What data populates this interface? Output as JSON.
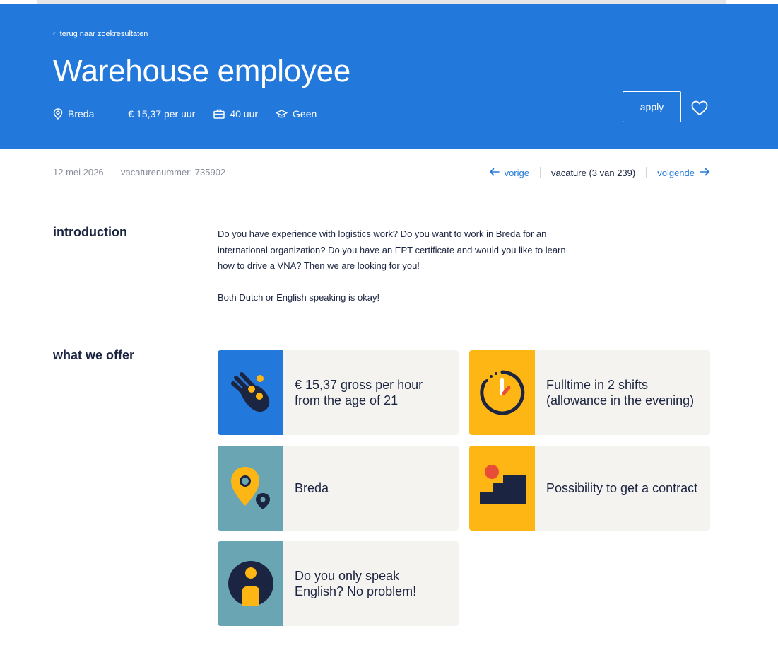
{
  "header": {
    "back_link": "terug naar zoekresultaten",
    "title": "Warehouse employee",
    "meta": {
      "location": "Breda",
      "salary": "€ 15,37 per uur",
      "hours": "40 uur",
      "education": "Geen"
    },
    "apply_label": "apply"
  },
  "info": {
    "date": "12 mei 2026",
    "vacancy_number": "vacaturenummer: 735902",
    "prev_label": "vorige",
    "count_label": "vacature (3 van 239)",
    "next_label": "volgende"
  },
  "introduction": {
    "heading": "introduction",
    "paragraphs": [
      "Do you have experience with logistics work? Do you want to work in Breda for an international organization? Do you have an EPT certificate and would you like to learn how to drive a VNA? Then we are looking for you!",
      "Both Dutch or English speaking is okay!"
    ]
  },
  "offer": {
    "heading": "what we offer",
    "cards": [
      {
        "text": "€ 15,37 gross per hour from the age of 21",
        "icon": "hand-coins-icon",
        "bg": "#2378db"
      },
      {
        "text": "Fulltime in 2 shifts (allowance in the evening)",
        "icon": "stopwatch-icon",
        "bg": "#fdb614"
      },
      {
        "text": "Breda",
        "icon": "location-pins-icon",
        "bg": "#6aa5b3"
      },
      {
        "text": "Possibility to get a contract",
        "icon": "stairs-icon",
        "bg": "#fdb614"
      },
      {
        "text": "Do you only speak English? No problem!",
        "icon": "person-icon",
        "bg": "#6aa5b3"
      }
    ]
  },
  "colors": {
    "brand_blue": "#2378db",
    "navy": "#1b2440",
    "yellow": "#fdb614",
    "teal": "#6aa5b3",
    "card_bg": "#f4f3ef"
  }
}
